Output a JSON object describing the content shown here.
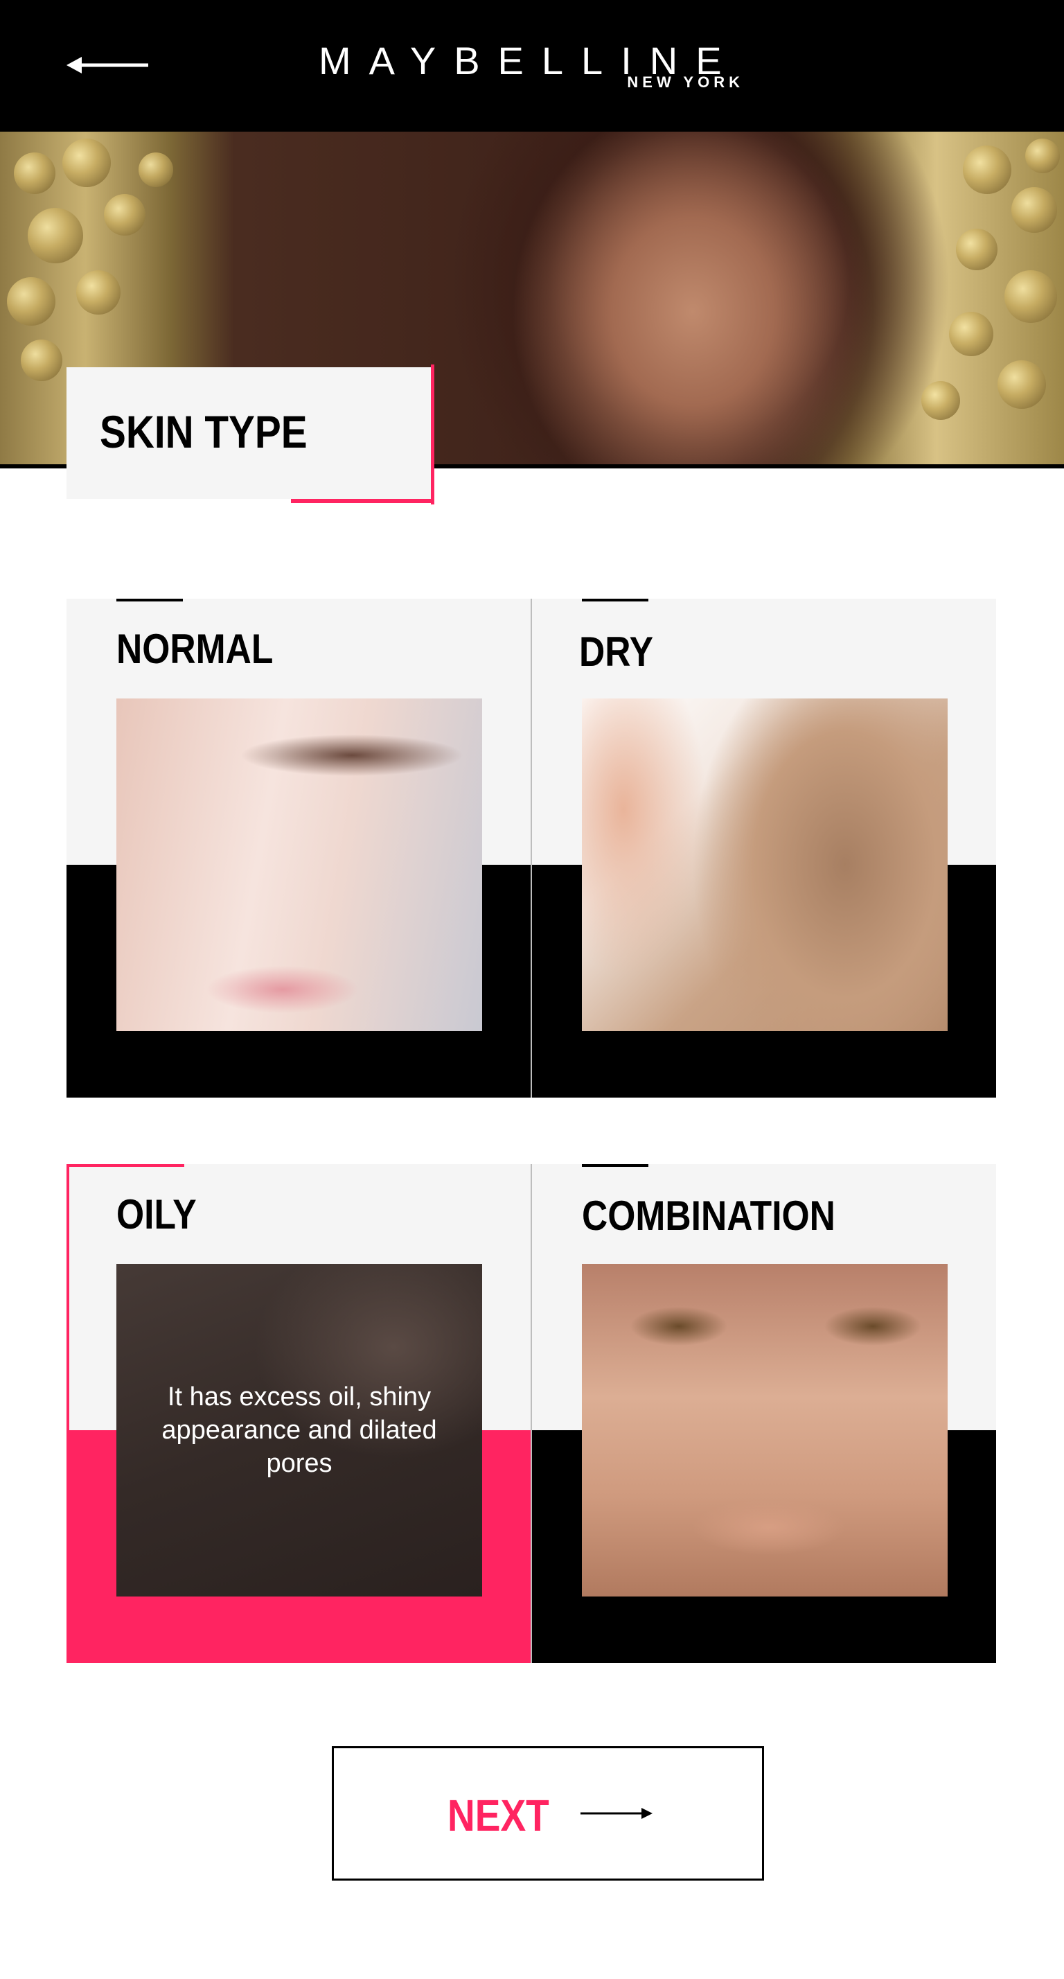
{
  "header": {
    "brand": "MAYBELLINE",
    "brand_sub": "NEW YORK",
    "back_icon": "arrow-left-icon"
  },
  "page": {
    "title": "SKIN TYPE"
  },
  "skin_types": [
    {
      "label": "NORMAL",
      "description": "",
      "selected": false
    },
    {
      "label": "DRY",
      "description": "",
      "selected": false
    },
    {
      "label": "OILY",
      "description": "It has excess oil, shiny appearance and dilated pores",
      "selected": true
    },
    {
      "label": "COMBINATION",
      "description": "",
      "selected": false
    }
  ],
  "next": {
    "label": "NEXT",
    "icon": "arrow-right-icon"
  },
  "colors": {
    "accent": "#ff2461",
    "header_bg": "#000000",
    "card_bg": "#f5f5f5"
  }
}
